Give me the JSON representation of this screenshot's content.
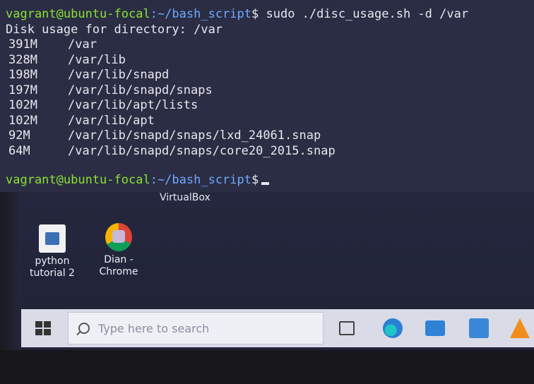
{
  "terminal": {
    "prompt_user": "vagrant@ubuntu-focal",
    "prompt_path": ":~/bash_script",
    "prompt_symbol": "$",
    "command": " sudo ./disc_usage.sh -d /var",
    "header": "Disk usage for directory: /var",
    "rows": [
      {
        "size": "391M",
        "path": "/var"
      },
      {
        "size": "328M",
        "path": "/var/lib"
      },
      {
        "size": "198M",
        "path": "/var/lib/snapd"
      },
      {
        "size": "197M",
        "path": "/var/lib/snapd/snaps"
      },
      {
        "size": "102M",
        "path": "/var/lib/apt/lists"
      },
      {
        "size": "102M",
        "path": "/var/lib/apt"
      },
      {
        "size": "92M",
        "path": "/var/lib/snapd/snaps/lxd_24061.snap"
      },
      {
        "size": "64M",
        "path": "/var/lib/snapd/snaps/core20_2015.snap"
      }
    ]
  },
  "window": {
    "title": "VirtualBox"
  },
  "desktop": {
    "icons": [
      {
        "label_line1": "python",
        "label_line2": "tutorial 2",
        "icon": "document-icon"
      },
      {
        "label_line1": "Dian -",
        "label_line2": "Chrome",
        "icon": "chrome-profile-icon"
      }
    ]
  },
  "taskbar": {
    "search_placeholder": "Type here to search",
    "icons": [
      "windows-start-icon",
      "task-view-icon",
      "edge-icon",
      "mail-icon",
      "store-icon",
      "vlc-icon"
    ]
  },
  "colors": {
    "prompt_user": "#8ae234",
    "prompt_path": "#6fa8ff",
    "terminal_bg": "#2b2d44",
    "taskbar_bg": "#d9dbe6"
  }
}
